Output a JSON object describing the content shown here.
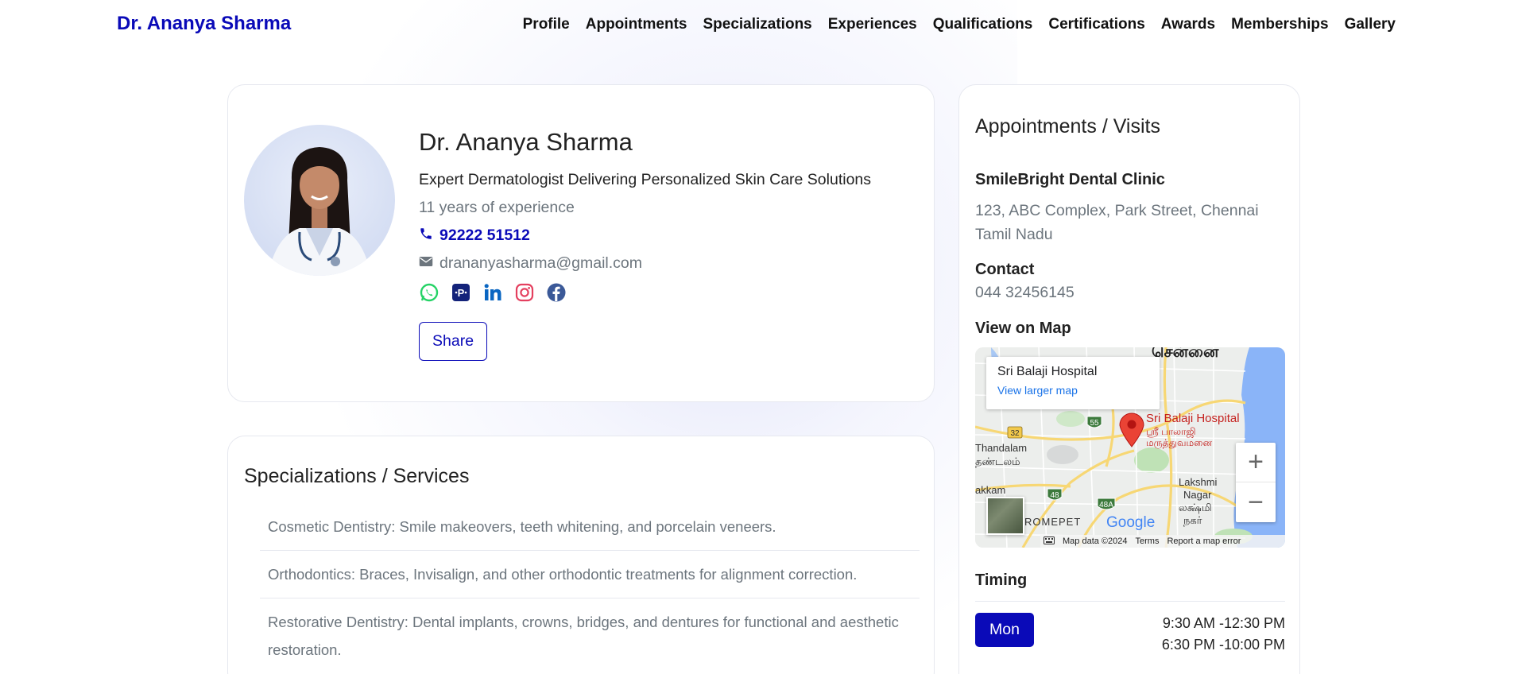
{
  "nav": {
    "brand": "Dr. Ananya Sharma",
    "links": [
      "Profile",
      "Appointments",
      "Specializations",
      "Experiences",
      "Qualifications",
      "Certifications",
      "Awards",
      "Memberships",
      "Gallery"
    ]
  },
  "profile": {
    "name": "Dr. Ananya Sharma",
    "tagline": "Expert Dermatologist Delivering Personalized Skin Care Solutions",
    "experience": "11 years of experience",
    "phone": "92222 51512",
    "email": "drananyasharma@gmail.com",
    "socials": [
      "whatsapp-icon",
      "practo-icon",
      "linkedin-icon",
      "instagram-icon",
      "facebook-icon"
    ],
    "share_label": "Share"
  },
  "specializations": {
    "title": "Specializations / Services",
    "items": [
      "Cosmetic Dentistry: Smile makeovers, teeth whitening, and porcelain veneers.",
      "Orthodontics: Braces, Invisalign, and other orthodontic treatments for alignment correction.",
      "Restorative Dentistry: Dental implants, crowns, bridges, and dentures for functional and aesthetic restoration."
    ]
  },
  "appointments": {
    "title": "Appointments / Visits",
    "clinic_name": "SmileBright Dental Clinic",
    "address_line1": "123, ABC Complex, Park Street, Chennai",
    "address_line2": "Tamil Nadu",
    "contact_label": "Contact",
    "contact_number": "044 32456145",
    "map_label": "View on Map",
    "map": {
      "place_name": "Sri Balaji Hospital",
      "larger_map_link": "View larger map",
      "pin_label": "Sri Balaji Hospital",
      "pin_label_tamil": "ஸ்ரீ பாலாஜி",
      "pin_label_tamil2": "மருத்துவமனை",
      "labels": {
        "thandalam": "Thandalam",
        "thandalam_tamil": "தண்டலம்",
        "lakshmi": "Lakshmi",
        "nagar": "Nagar",
        "lakshmi_tamil": "லக்ஷ்மி",
        "nagar_tamil": "நகர்",
        "akkam": "akkam",
        "chromepet": "ROMEPET",
        "top_tamil": "சென்னை",
        "road_32": "32",
        "road_55": "55",
        "road_48": "48",
        "road_48a": "48A"
      },
      "google": "Google",
      "map_data": "Map data ©2024",
      "terms": "Terms",
      "report": "Report a map error",
      "zoom_in": "+",
      "zoom_out": "−"
    },
    "timing_label": "Timing",
    "timings": [
      {
        "day": "Mon",
        "slot1": "9:30 AM -12:30 PM",
        "slot2": "6:30 PM -10:00 PM"
      }
    ]
  },
  "colors": {
    "accent": "#0a0ab8",
    "muted": "#6c757d"
  }
}
